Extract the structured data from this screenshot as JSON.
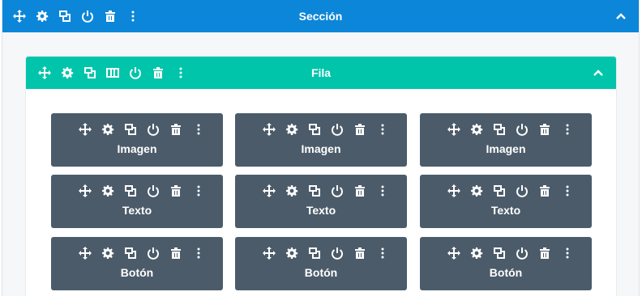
{
  "section": {
    "title": "Sección",
    "color": "#0c86d8",
    "toolbar": [
      "move-icon",
      "gear-icon",
      "duplicate-icon",
      "power-icon",
      "trash-icon",
      "more-icon"
    ]
  },
  "row": {
    "title": "Fila",
    "color": "#00c5ab",
    "toolbar": [
      "move-icon",
      "gear-icon",
      "duplicate-icon",
      "columns-icon",
      "power-icon",
      "trash-icon",
      "more-icon"
    ]
  },
  "modules": {
    "color": "#4b5b6a",
    "toolbar": [
      "move-icon",
      "gear-icon",
      "duplicate-icon",
      "power-icon",
      "trash-icon",
      "more-icon"
    ],
    "items": [
      {
        "label": "Imagen"
      },
      {
        "label": "Imagen"
      },
      {
        "label": "Imagen"
      },
      {
        "label": "Texto"
      },
      {
        "label": "Texto"
      },
      {
        "label": "Texto"
      },
      {
        "label": "Botón"
      },
      {
        "label": "Botón"
      },
      {
        "label": "Botón"
      }
    ]
  }
}
